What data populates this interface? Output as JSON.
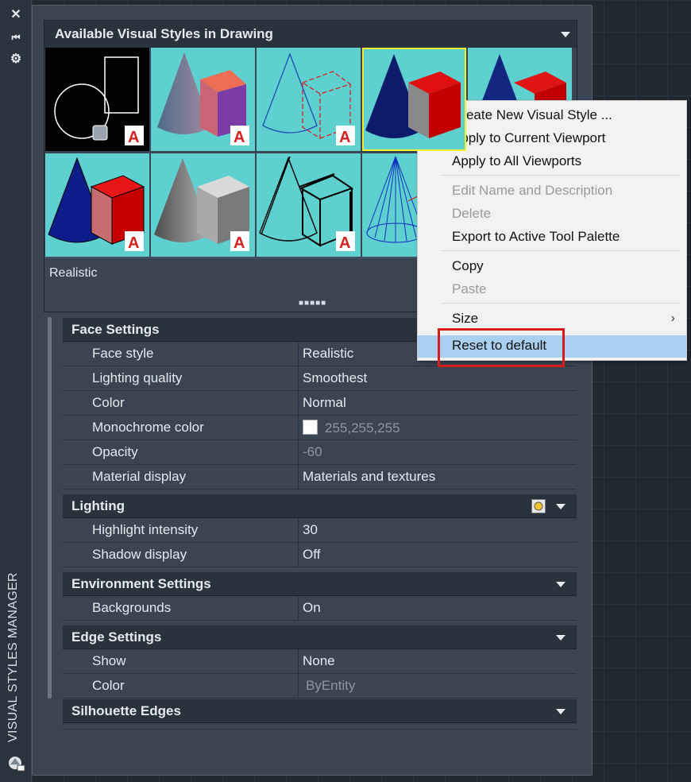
{
  "side_strip": {
    "title": "VISUAL STYLES MANAGER",
    "icons": [
      "close-icon",
      "collapse-icon",
      "settings-icon",
      "properties-icon"
    ]
  },
  "visual_styles": {
    "header": "Available Visual Styles in Drawing",
    "current_style": "Realistic",
    "thumbnails": [
      {
        "style": "wireframe-2d",
        "badge": "A"
      },
      {
        "style": "conceptual",
        "badge": "A"
      },
      {
        "style": "hidden",
        "badge": "A"
      },
      {
        "style": "realistic",
        "badge": "",
        "selected": true
      },
      {
        "style": "shaded",
        "badge": ""
      },
      {
        "style": "shaded-with-edges",
        "badge": "A"
      },
      {
        "style": "shades-of-gray",
        "badge": "A"
      },
      {
        "style": "sketchy",
        "badge": "A"
      },
      {
        "style": "wireframe",
        "badge": ""
      }
    ]
  },
  "properties": {
    "face_settings": {
      "title": "Face Settings",
      "rows": [
        {
          "label": "Face style",
          "value": "Realistic"
        },
        {
          "label": "Lighting quality",
          "value": "Smoothest"
        },
        {
          "label": "Color",
          "value": "Normal"
        },
        {
          "label": "Monochrome color",
          "value": "255,255,255",
          "swatch": "#ffffff"
        },
        {
          "label": "Opacity",
          "value": "-60"
        },
        {
          "label": "Material display",
          "value": "Materials and textures"
        }
      ]
    },
    "lighting": {
      "title": "Lighting",
      "rows": [
        {
          "label": "Highlight intensity",
          "value": "30"
        },
        {
          "label": "Shadow display",
          "value": "Off"
        }
      ]
    },
    "environment": {
      "title": "Environment Settings",
      "rows": [
        {
          "label": "Backgrounds",
          "value": "On"
        }
      ]
    },
    "edge": {
      "title": "Edge Settings",
      "rows": [
        {
          "label": "Show",
          "value": "None"
        },
        {
          "label": "Color",
          "value": "ByEntity"
        }
      ]
    },
    "silhouette": {
      "title": "Silhouette Edges"
    }
  },
  "context_menu": {
    "items": [
      {
        "label": "Create New Visual Style ...",
        "enabled": true
      },
      {
        "label": "Apply to Current Viewport",
        "enabled": true
      },
      {
        "label": "Apply to All Viewports",
        "enabled": true
      },
      {
        "label": "Edit Name and Description",
        "enabled": false
      },
      {
        "label": "Delete",
        "enabled": false
      },
      {
        "label": "Export to Active Tool Palette",
        "enabled": true
      },
      {
        "label": "Copy",
        "enabled": true
      },
      {
        "label": "Paste",
        "enabled": false
      },
      {
        "label": "Size",
        "enabled": true,
        "submenu": true
      },
      {
        "label": "Reset to default",
        "enabled": true,
        "highlighted": true
      }
    ]
  },
  "colors": {
    "thumbnail_bg": "#5fd0d0",
    "selection_outline": "#f6f12b",
    "highlight": "#a9cff1",
    "callout": "#d81b1b"
  }
}
